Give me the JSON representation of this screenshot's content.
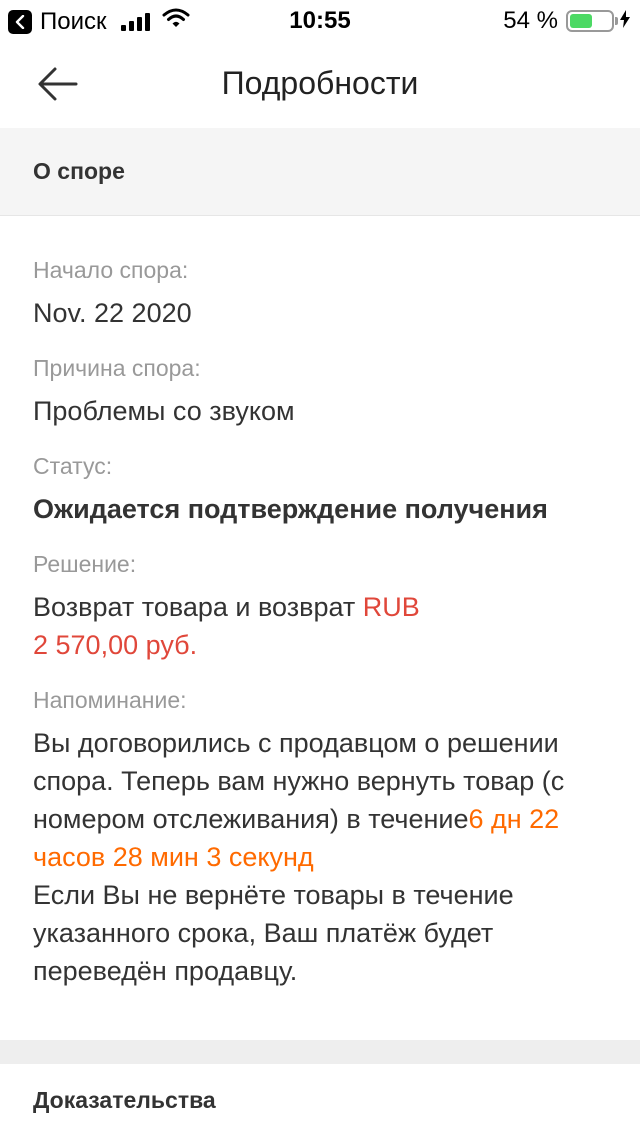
{
  "status_bar": {
    "carrier": "Поиск",
    "time": "10:55",
    "battery": "54 %",
    "battery_level": 0.54
  },
  "nav": {
    "title": "Подробности"
  },
  "about": {
    "header": "О споре",
    "start_label": "Начало спора:",
    "start_value": "Nov. 22 2020",
    "reason_label": "Причина спора:",
    "reason_value": "Проблемы со звуком",
    "status_label": "Статус:",
    "status_value": "Ожидается подтверждение получения",
    "solution_label": "Решение:",
    "solution_text": "Возврат товара и возврат ",
    "solution_currency": "RUB",
    "solution_amount": "2 570,00 руб.",
    "reminder_label": "Напоминание:",
    "reminder_text_1": "Вы договорились с продавцом о решении спора. Теперь вам нужно вернуть товар (с номером отслеживания) в течение",
    "reminder_countdown": "6 дн 22 часов 28 мин 3 секунд",
    "reminder_text_2": "Если Вы не вернёте товары в течение указанного срока, Ваш платёж будет переведён продавцу."
  },
  "evidence": {
    "header": "Доказательства"
  },
  "colors": {
    "accent_red": "#e0473a",
    "accent_orange": "#ff6a00",
    "battery_green": "#4cd964"
  }
}
